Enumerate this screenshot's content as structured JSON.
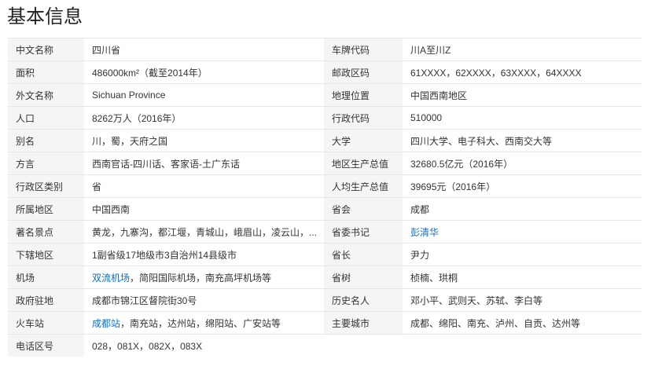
{
  "page_title": "基本信息",
  "rows": [
    {
      "k1": "中文名称",
      "v1": "四川省",
      "k2": "车牌代码",
      "v2": "川A至川Z"
    },
    {
      "k1": "面积",
      "v1": "486000km²（截至2014年）",
      "k2": "邮政区码",
      "v2": "61XXXX，62XXXX，63XXXX，64XXXX"
    },
    {
      "k1": "外文名称",
      "v1": "Sichuan Province",
      "k2": "地理位置",
      "v2": "中国西南地区"
    },
    {
      "k1": "人口",
      "v1": "8262万人（2016年）",
      "k2": "行政代码",
      "v2": "510000"
    },
    {
      "k1": "别名",
      "v1": "川，蜀，天府之国",
      "k2": "大学",
      "v2": "四川大学、电子科大、西南交大等"
    },
    {
      "k1": "方言",
      "v1": "西南官话-四川话、客家语-土广东话",
      "k2": "地区生产总值",
      "v2": "32680.5亿元（2016年）"
    },
    {
      "k1": "行政区类别",
      "v1": "省",
      "k2": "人均生产总值",
      "v2": "39695元（2016年）"
    },
    {
      "k1": "所属地区",
      "v1": "中国西南",
      "k2": "省会",
      "v2": "成都"
    },
    {
      "k1": "著名景点",
      "v1": "黄龙，九寨沟，都江堰，青城山，峨眉山，凌云山，...",
      "k2": "省委书记",
      "v2_link": "彭清华"
    },
    {
      "k1": "下辖地区",
      "v1": "1副省级17地级市3自治州14县级市",
      "k2": "省长",
      "v2": "尹力"
    },
    {
      "k1": "机场",
      "v1_link": "双流机场",
      "v1_rest": "，简阳国际机场，南充高坪机场等",
      "k2": "省树",
      "v2": "桢楠、珙桐"
    },
    {
      "k1": "政府驻地",
      "v1": "成都市锦江区督院街30号",
      "k2": "历史名人",
      "v2": "邓小平、武则天、苏轼、李白等"
    },
    {
      "k1": "火车站",
      "v1_link": "成都站",
      "v1_rest": "，南充站，达州站，绵阳站、广安站等",
      "k2": "主要城市",
      "v2": "成都、绵阳、南充、泸州、自贡、达州等"
    },
    {
      "k1": "电话区号",
      "v1": "028，081X，082X，083X"
    }
  ]
}
